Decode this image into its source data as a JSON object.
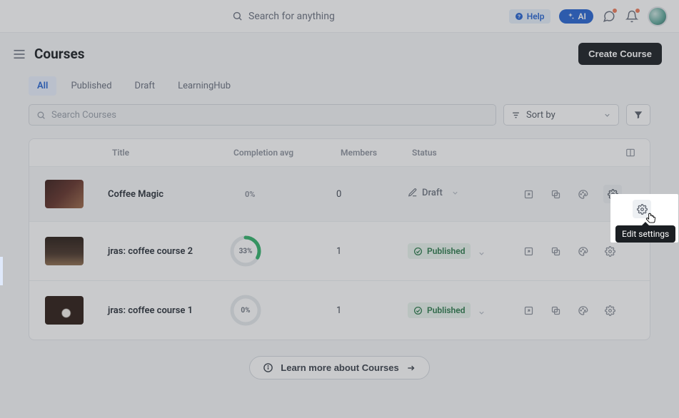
{
  "topbar": {
    "global_search_placeholder": "Search for anything",
    "help_label": "Help",
    "ai_label": "AI"
  },
  "page": {
    "title": "Courses",
    "create_button": "Create Course"
  },
  "tabs": [
    {
      "label": "All",
      "active": true
    },
    {
      "label": "Published",
      "active": false
    },
    {
      "label": "Draft",
      "active": false
    },
    {
      "label": "LearningHub",
      "active": false
    }
  ],
  "filters": {
    "search_placeholder": "Search Courses",
    "sort_label": "Sort by"
  },
  "table": {
    "columns": {
      "title": "Title",
      "completion": "Completion avg",
      "members": "Members",
      "status": "Status"
    },
    "rows": [
      {
        "title": "Coffee Magic",
        "completion_pct": 0,
        "completion_label": "0%",
        "members": "0",
        "status": "Draft",
        "status_kind": "draft",
        "donut": false
      },
      {
        "title": "jras: coffee course 2",
        "completion_pct": 33,
        "completion_label": "33%",
        "members": "1",
        "status": "Published",
        "status_kind": "published",
        "donut": true
      },
      {
        "title": "jras: coffee course 1",
        "completion_pct": 0,
        "completion_label": "0%",
        "members": "1",
        "status": "Published",
        "status_kind": "published",
        "donut": true
      }
    ]
  },
  "tooltip": {
    "edit_settings": "Edit settings"
  },
  "footer": {
    "learn_more": "Learn more about Courses"
  },
  "colors": {
    "accent_blue": "#2766d3",
    "published_green": "#2c7a4b",
    "dark": "#1b1f23"
  }
}
